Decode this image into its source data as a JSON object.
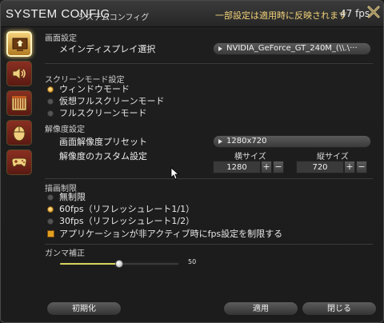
{
  "header": {
    "title": "SYSTEM CONFIG",
    "subtitle": "システムコンフィグ",
    "notice": "一部設定は適用時に反映されます",
    "fps": "47 fps"
  },
  "sidebar": {
    "categories": [
      {
        "icon": "display-icon",
        "active": true
      },
      {
        "icon": "speaker-icon",
        "active": false
      },
      {
        "icon": "theater-curtain-icon",
        "active": false
      },
      {
        "icon": "mouse-icon",
        "active": false
      },
      {
        "icon": "gamepad-icon",
        "active": false
      }
    ]
  },
  "display": {
    "section": "画面設定",
    "display_label": "メインディスプレイ選択",
    "display_value": "NVIDIA_GeForce_GT_240M_(\\\\.\\···"
  },
  "screen_mode": {
    "section": "スクリーンモード設定",
    "options": [
      "ウィンドウモード",
      "仮想フルスクリーンモード",
      "フルスクリーンモード"
    ],
    "selected": 0
  },
  "resolution": {
    "section": "解像度設定",
    "preset_label": "画面解像度プリセット",
    "preset_value": "1280x720",
    "custom_label": "解像度のカスタム設定",
    "width_header": "横サイズ",
    "height_header": "縦サイズ",
    "width_value": "1280",
    "height_value": "720",
    "plus": "+",
    "minus": "−"
  },
  "frame_limit": {
    "section": "描画制限",
    "options": [
      "無制限",
      "60fps（リフレッシュレート1/1）",
      "30fps（リフレッシュレート1/2）"
    ],
    "selected": 1,
    "inactive_checkbox_label": "アプリケーションが非アクティブ時にfps設定を制限する",
    "inactive_checked": true
  },
  "gamma": {
    "section": "ガンマ補正",
    "value": "50",
    "fraction": 0.5
  },
  "footer": {
    "reset": "初期化",
    "apply": "適用",
    "close": "閉じる"
  },
  "colors": {
    "accent": "#e0a020",
    "notice": "#f3d37a",
    "slider": "#d7d35a"
  }
}
